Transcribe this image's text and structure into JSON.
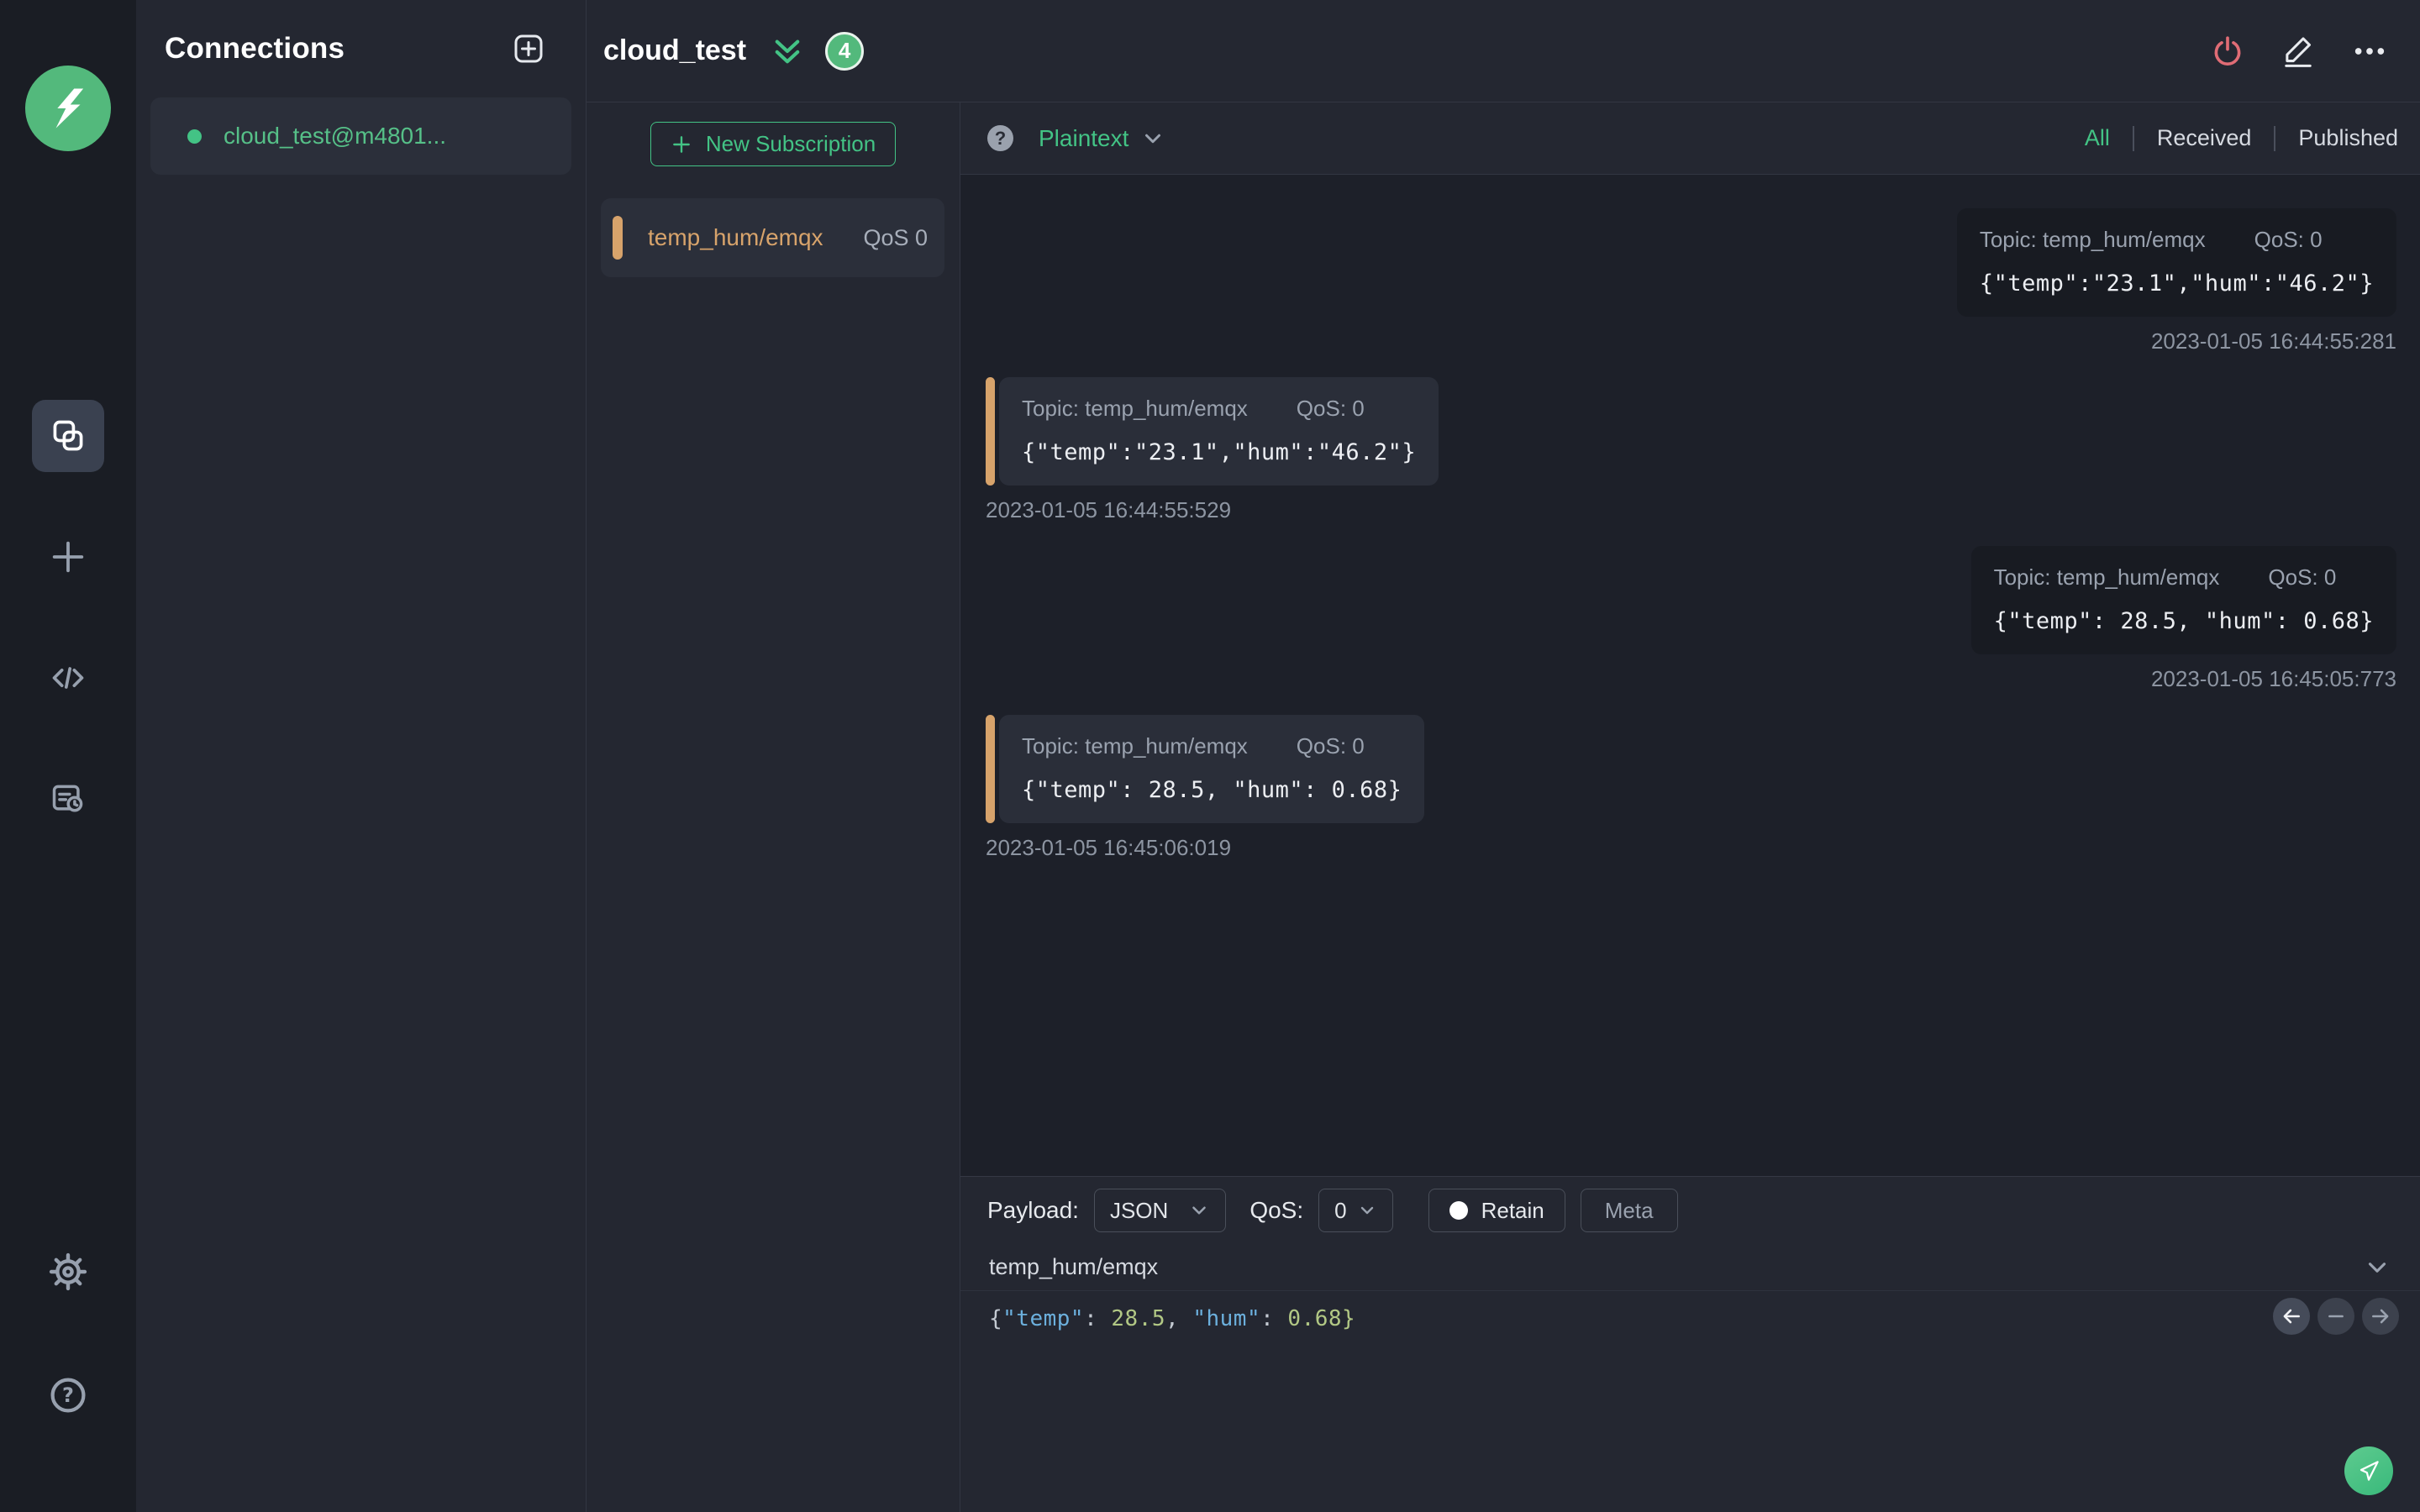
{
  "colors": {
    "accent_green": "#43c385",
    "accent_orange": "#d7a36b",
    "power_red": "#e06c75",
    "received_card_bg": "#2a2e39",
    "published_card_bg": "#181b22"
  },
  "connections_panel": {
    "title": "Connections",
    "items": [
      {
        "label": "cloud_test@m4801...",
        "connected": true
      }
    ]
  },
  "header": {
    "title": "cloud_test",
    "badge_count": "4"
  },
  "subscriptions": {
    "new_button_label": "New Subscription",
    "items": [
      {
        "topic": "temp_hum/emqx",
        "qos": "QoS 0"
      }
    ]
  },
  "messages": {
    "format_selected": "Plaintext",
    "filters": [
      {
        "label": "All",
        "active": true
      },
      {
        "label": "Received",
        "active": false
      },
      {
        "label": "Published",
        "active": false
      }
    ],
    "items": [
      {
        "direction": "published",
        "topic": "Topic: temp_hum/emqx",
        "qos": "QoS: 0",
        "payload": "{\"temp\":\"23.1\",\"hum\":\"46.2\"}",
        "timestamp": "2023-01-05 16:44:55:281"
      },
      {
        "direction": "received",
        "topic": "Topic: temp_hum/emqx",
        "qos": "QoS: 0",
        "payload": "{\"temp\":\"23.1\",\"hum\":\"46.2\"}",
        "timestamp": "2023-01-05 16:44:55:529"
      },
      {
        "direction": "published",
        "topic": "Topic: temp_hum/emqx",
        "qos": "QoS: 0",
        "payload": "{\"temp\": 28.5, \"hum\": 0.68}",
        "timestamp": "2023-01-05 16:45:05:773"
      },
      {
        "direction": "received",
        "topic": "Topic: temp_hum/emqx",
        "qos": "QoS: 0",
        "payload": "{\"temp\": 28.5, \"hum\": 0.68}",
        "timestamp": "2023-01-05 16:45:06:019"
      }
    ]
  },
  "publish": {
    "payload_label": "Payload:",
    "payload_format": "JSON",
    "qos_label": "QoS:",
    "qos_value": "0",
    "retain_label": "Retain",
    "meta_label": "Meta",
    "topic": "temp_hum/emqx",
    "payload_text": "{\"temp\": 28.5, \"hum\": 0.68}",
    "payload_tokens": [
      {
        "c": "punc",
        "t": "{"
      },
      {
        "c": "key",
        "t": "\"temp\""
      },
      {
        "c": "punc",
        "t": ": "
      },
      {
        "c": "num",
        "t": "28.5"
      },
      {
        "c": "punc",
        "t": ", "
      },
      {
        "c": "key",
        "t": "\"hum\""
      },
      {
        "c": "punc",
        "t": ": "
      },
      {
        "c": "num",
        "t": "0.68"
      },
      {
        "c": "num",
        "t": "}"
      }
    ]
  }
}
